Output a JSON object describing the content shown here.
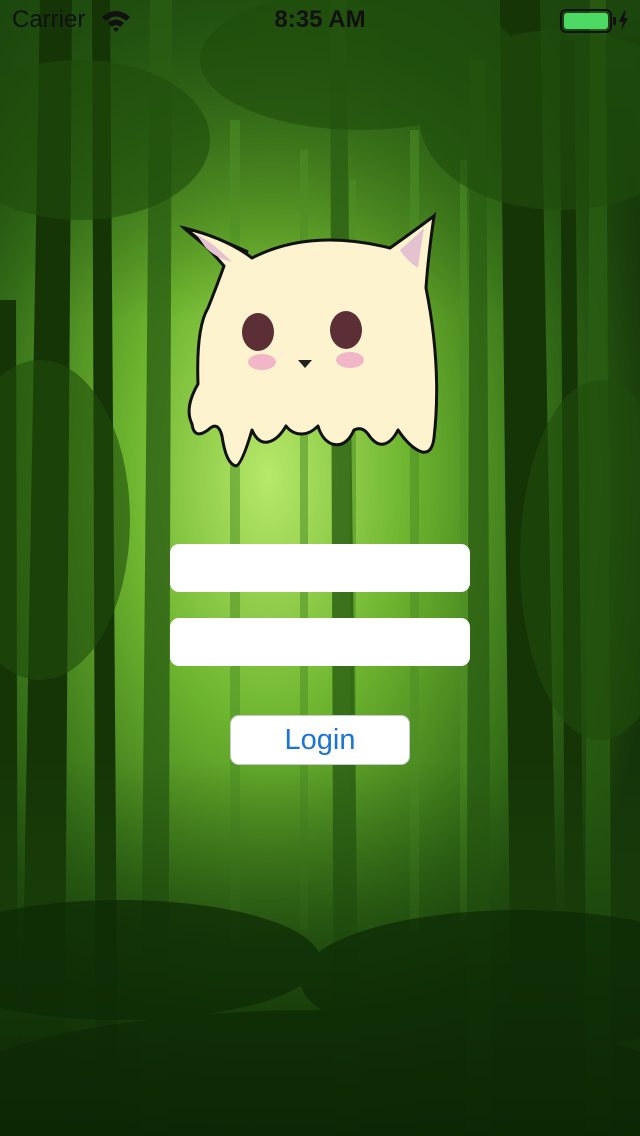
{
  "status_bar": {
    "carrier": "Carrier",
    "time": "8:35 AM",
    "wifi_icon": "wifi-icon",
    "battery_icon": "battery-charging-icon",
    "battery_color": "#4cd964"
  },
  "background": {
    "description_icon": "forest-background",
    "colors": {
      "light": "#8fcf4a",
      "mid": "#3f7d1e",
      "dark": "#0f2a06"
    }
  },
  "mascot": {
    "icon": "ghost-cat-mascot",
    "body_color": "#fdf3cf",
    "ear_color": "#e4c2cf",
    "eye_color": "#5b2f35",
    "cheek_color": "#f1b7c8"
  },
  "login_form": {
    "username": {
      "value": "",
      "placeholder": ""
    },
    "password": {
      "value": "",
      "placeholder": ""
    },
    "login_label": "Login",
    "login_color": "#1a73d9"
  }
}
